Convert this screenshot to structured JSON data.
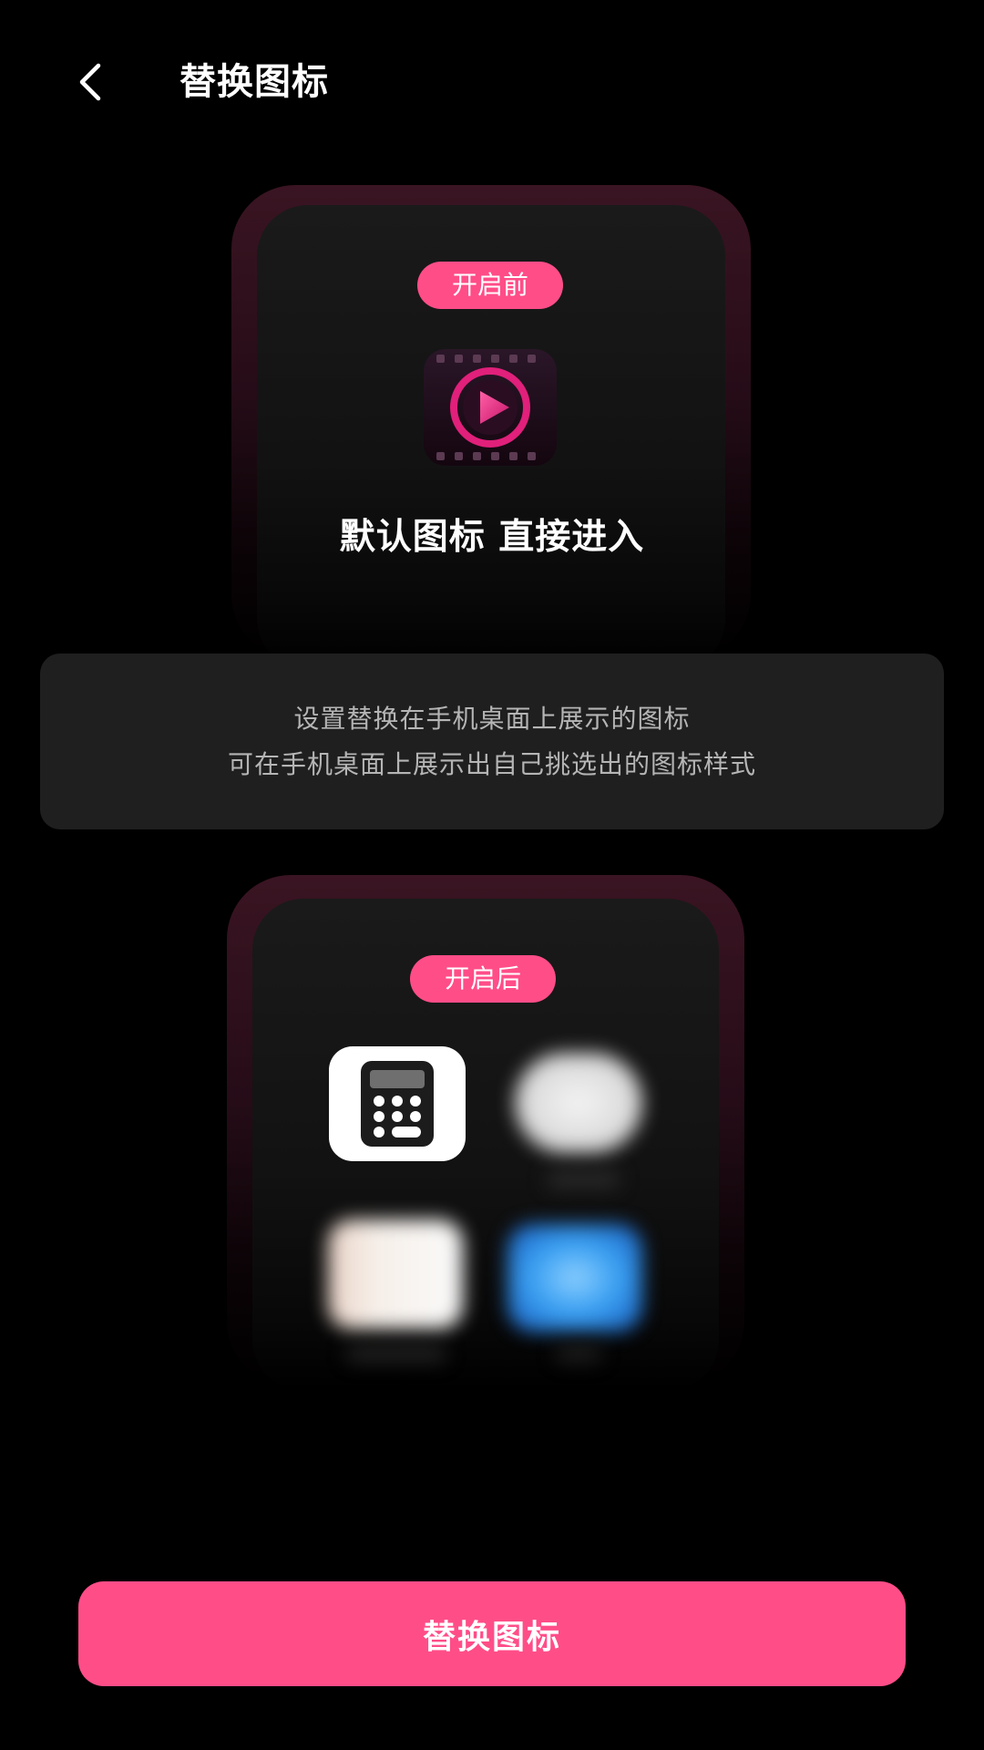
{
  "header": {
    "back_icon": "chevron-left-icon",
    "title": "替换图标"
  },
  "before_card": {
    "badge": "开启前",
    "app_icon": "video-play-icon",
    "caption": "默认图标 直接进入"
  },
  "info": {
    "line1": "设置替换在手机桌面上展示的图标",
    "line2": "可在手机桌面上展示出自己挑选出的图标样式"
  },
  "after_card": {
    "badge": "开启后",
    "icons": [
      "calculator-icon",
      "clock-icon",
      "notes-icon",
      "screen-icon"
    ]
  },
  "action": {
    "label": "替换图标"
  },
  "colors": {
    "accent": "#ff4d88",
    "background": "#000000",
    "panel": "#1f1f1f"
  }
}
